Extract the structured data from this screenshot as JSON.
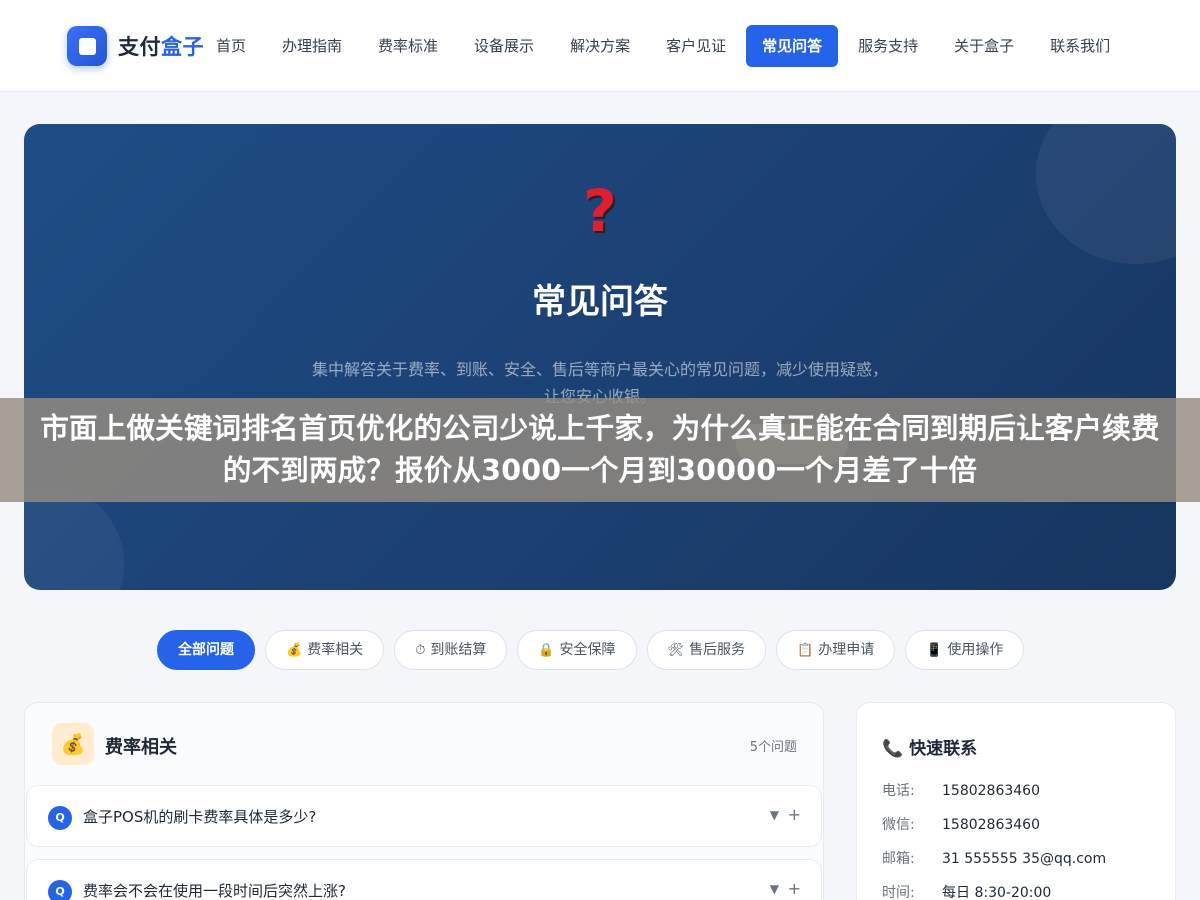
{
  "header": {
    "logo_text_part1": "支付",
    "logo_text_part2": "盒子",
    "nav": [
      {
        "label": "首页",
        "active": false
      },
      {
        "label": "办理指南",
        "active": false
      },
      {
        "label": "费率标准",
        "active": false
      },
      {
        "label": "设备展示",
        "active": false
      },
      {
        "label": "解决方案",
        "active": false
      },
      {
        "label": "客户见证",
        "active": false
      },
      {
        "label": "常见问答",
        "active": true
      },
      {
        "label": "服务支持",
        "active": false
      },
      {
        "label": "关于盒子",
        "active": false
      },
      {
        "label": "联系我们",
        "active": false
      }
    ]
  },
  "hero": {
    "icon": "question-mark-icon",
    "icon_glyph": "?",
    "title": "常见问答",
    "description": "集中解答关于费率、到账、安全、售后等商户最关心的常见问题，减少使用疑惑，让您安心收银。"
  },
  "overlay": {
    "text": "市面上做关键词排名首页优化的公司少说上千家，为什么真正能在合同到期后让客户续费的不到两成？报价从3000一个月到30000一个月差了十倍"
  },
  "filters": [
    {
      "label": "全部问题",
      "icon": "",
      "active": true
    },
    {
      "label": "费率相关",
      "icon": "💰",
      "active": false
    },
    {
      "label": "到账结算",
      "icon": "⏱",
      "active": false
    },
    {
      "label": "安全保障",
      "icon": "🔒",
      "active": false
    },
    {
      "label": "售后服务",
      "icon": "🛠",
      "active": false
    },
    {
      "label": "办理申请",
      "icon": "📋",
      "active": false
    },
    {
      "label": "使用操作",
      "icon": "📱",
      "active": false
    }
  ],
  "faq_section": {
    "icon": "💰",
    "title": "费率相关",
    "count": "5个问题",
    "questions": [
      {
        "badge": "Q",
        "text": "盒子POS机的刷卡费率具体是多少?"
      },
      {
        "badge": "Q",
        "text": "费率会不会在使用一段时间后突然上涨?"
      }
    ],
    "arrow_glyph": "▼",
    "plus_glyph": "+"
  },
  "contact": {
    "icon": "📞",
    "title": "快速联系",
    "rows": [
      {
        "label": "电话:",
        "value": "15802863460"
      },
      {
        "label": "微信:",
        "value": "15802863460"
      },
      {
        "label": "邮箱:",
        "value": "31 555555 35@qq.com"
      },
      {
        "label": "时间:",
        "value": "每日 8:30-20:00"
      }
    ]
  }
}
